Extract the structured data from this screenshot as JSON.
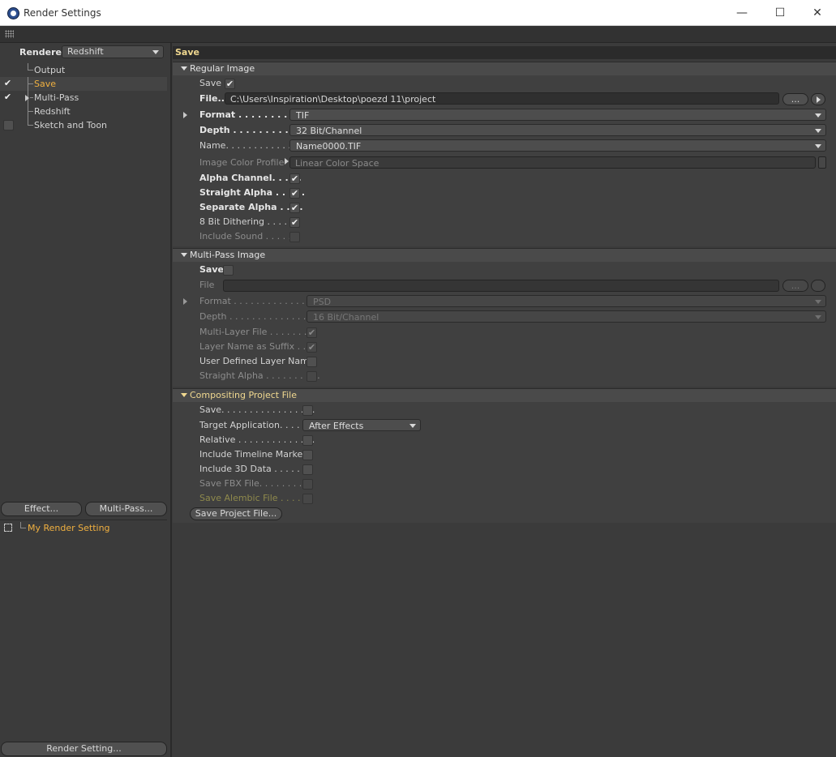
{
  "window": {
    "title": "Render Settings",
    "minimize": "—",
    "maximize": "☐",
    "close": "✕"
  },
  "left": {
    "renderer_label": "Renderer",
    "renderer_value": "Redshift",
    "tree": [
      {
        "label": "Output",
        "checked": false,
        "has_check": false
      },
      {
        "label": "Save",
        "checked": true,
        "has_check": true
      },
      {
        "label": "Multi-Pass",
        "checked": true,
        "has_check": true
      },
      {
        "label": "Redshift",
        "checked": false,
        "has_check": false
      },
      {
        "label": "Sketch and Toon",
        "checked": false,
        "has_check": true
      }
    ],
    "effect_btn": "Effect...",
    "multipass_btn": "Multi-Pass...",
    "my_render_setting": "My Render Setting",
    "render_setting_btn": "Render Setting..."
  },
  "main": {
    "title": "Save",
    "regular": {
      "header": "Regular Image",
      "save": "Save",
      "file_label": "File...",
      "file_path": "C:\\Users\\Inspiration\\Desktop\\poezd 11\\project",
      "dots": "...",
      "format_label": "Format . . . . . . . . . . . .",
      "format_value": "TIF",
      "depth_label": "Depth . . . . . . . . . . . .",
      "depth_value": "32 Bit/Channel",
      "name_label": "Name. . . . . . . . . . . . .",
      "name_value": "Name0000.TIF",
      "profile_label": "Image Color Profile",
      "profile_value": "Linear Color Space",
      "alpha": "Alpha Channel. . . . .",
      "straight": "Straight Alpha . . . . .",
      "separate": "Separate Alpha . . . .",
      "dither": "8 Bit Dithering . . . . .",
      "sound": "Include Sound . . . . ."
    },
    "multipass": {
      "header": "Multi-Pass Image",
      "save": "Save",
      "file_label": "File",
      "dots": "...",
      "format_label": "Format . . . . . . . . . . . . . . .",
      "format_value": "PSD",
      "depth_label": "Depth . . . . . . . . . . . . . . . .",
      "depth_value": "16 Bit/Channel",
      "multilayer": "Multi-Layer File . . . . . . . .",
      "suffix": "Layer Name as Suffix . . . .",
      "userdef": "User Defined Layer Name",
      "straight": "Straight Alpha . . . . . . . . . ."
    },
    "compositing": {
      "header": "Compositing Project File",
      "save": "Save. . . . . . . . . . . . . . . . .",
      "target_label": "Target Application. . . . .",
      "target_value": "After Effects",
      "relative": "Relative . . . . . . . . . . . . . .",
      "timeline": "Include Timeline Marker",
      "data3d": "Include 3D Data . . . . . . .",
      "fbx": "Save FBX File. . . . . . . . . .",
      "alembic": "Save Alembic File . . . . . .",
      "save_project_btn": "Save Project File..."
    }
  }
}
